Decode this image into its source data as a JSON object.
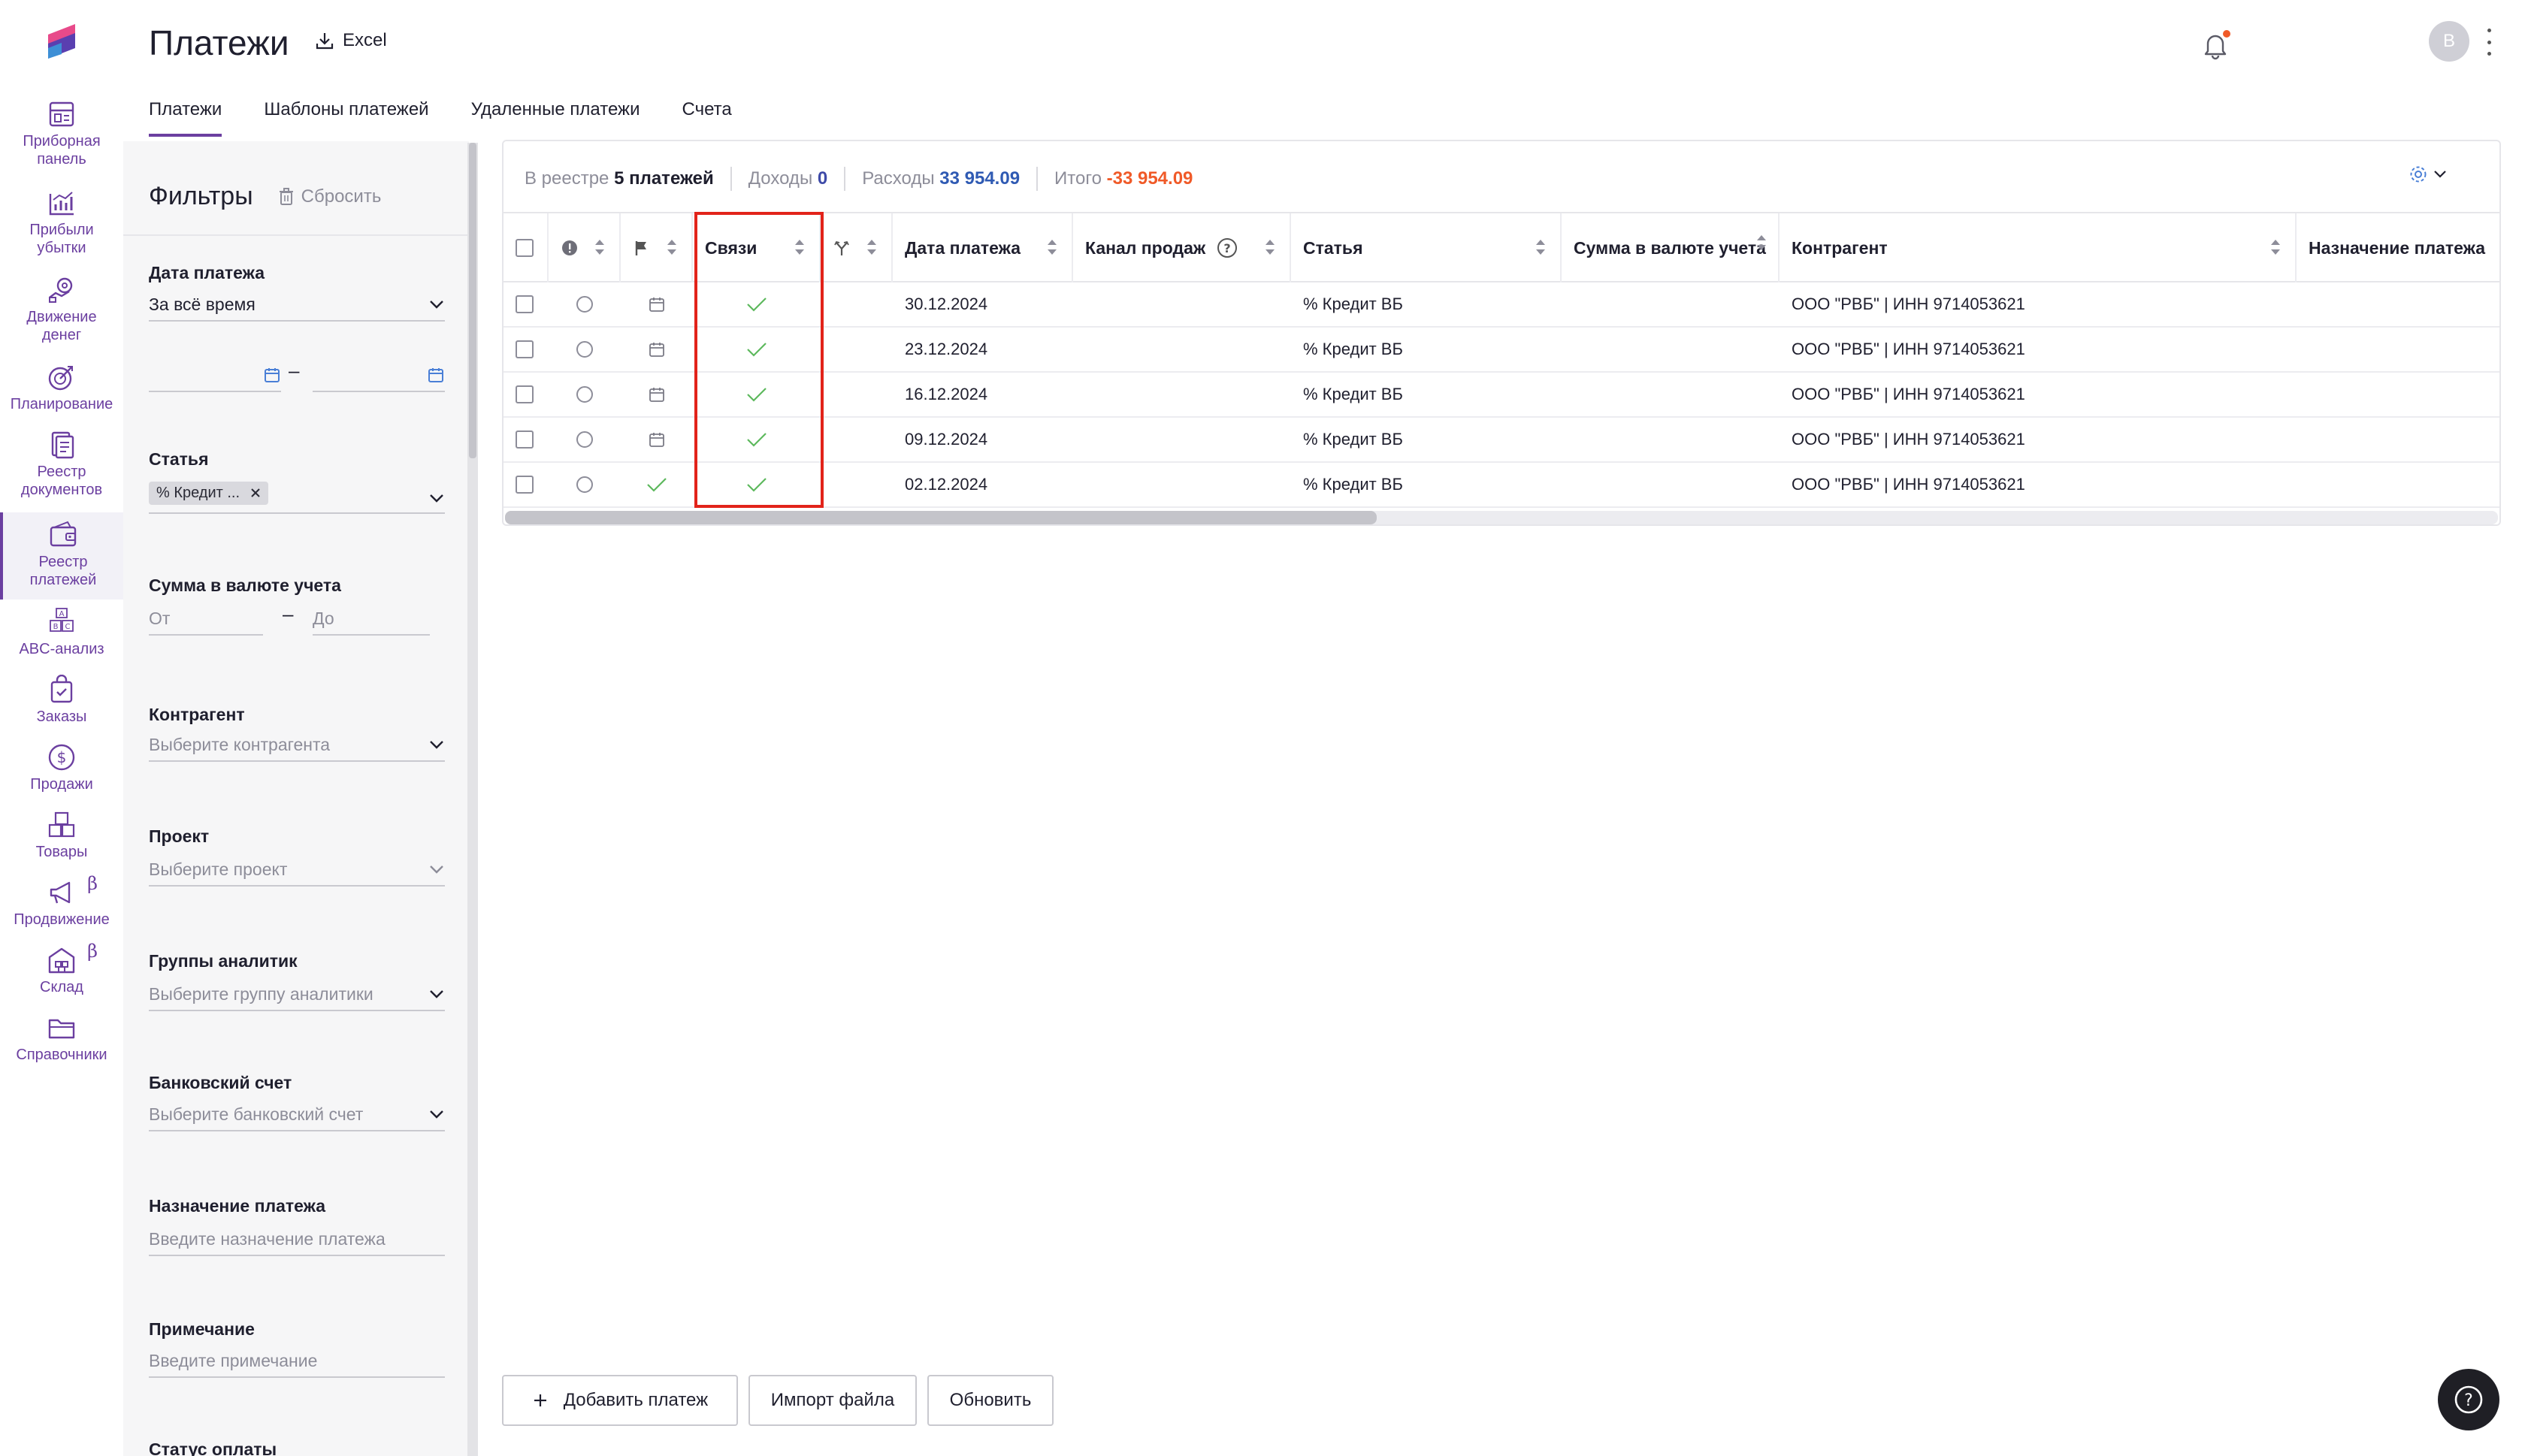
{
  "nav": {
    "items": [
      {
        "label": "Приборная\nпанель",
        "icon": "dashboard-icon"
      },
      {
        "label": "Прибыли\nубытки",
        "icon": "chart-icon"
      },
      {
        "label": "Движение\nденег",
        "icon": "money-flow-icon"
      },
      {
        "label": "Планирование",
        "icon": "target-icon"
      },
      {
        "label": "Реестр\nдокументов",
        "icon": "documents-icon"
      },
      {
        "label": "Реестр\nплатежей",
        "icon": "wallet-icon"
      },
      {
        "label": "ABC-анализ",
        "icon": "abc-icon"
      },
      {
        "label": "Заказы",
        "icon": "orders-icon"
      },
      {
        "label": "Продажи",
        "icon": "dollar-icon"
      },
      {
        "label": "Товары",
        "icon": "boxes-icon"
      },
      {
        "label": "Продвижение",
        "icon": "megaphone-icon",
        "beta": "β"
      },
      {
        "label": "Склад",
        "icon": "warehouse-icon",
        "beta": "β"
      },
      {
        "label": "Справочники",
        "icon": "folder-icon"
      }
    ]
  },
  "header": {
    "title": "Платежи",
    "excel": "Excel",
    "avatar": "В"
  },
  "tabs": [
    "Платежи",
    "Шаблоны платежей",
    "Удаленные платежи",
    "Счета"
  ],
  "filters": {
    "title": "Фильтры",
    "reset": "Сбросить",
    "date_label": "Дата платежа",
    "date_value": "За всё время",
    "date_dash": "–",
    "article_label": "Статья",
    "article_chip": "% Кредит ...",
    "amount_label": "Сумма в валюте учета",
    "amount_from": "От",
    "amount_to": "До",
    "amount_dash": "–",
    "counterparty_label": "Контрагент",
    "counterparty_ph": "Выберите контрагента",
    "project_label": "Проект",
    "project_ph": "Выберите проект",
    "groups_label": "Группы аналитик",
    "groups_ph": "Выберите группу аналитики",
    "bank_label": "Банковский счет",
    "bank_ph": "Выберите банковский счет",
    "purpose_label": "Назначение платежа",
    "purpose_ph": "Введите назначение платежа",
    "note_label": "Примечание",
    "note_ph": "Введите примечание",
    "status_label": "Статус оплаты"
  },
  "stats": {
    "registry_label": "В реестре",
    "registry_value": "5 платежей",
    "income_label": "Доходы",
    "income_value": "0",
    "expense_label": "Расходы",
    "expense_value": "33 954.09",
    "total_label": "Итого",
    "total_value": "-33 954.09"
  },
  "table": {
    "columns": {
      "links": "Связи",
      "date": "Дата платежа",
      "channel": "Канал продаж",
      "article": "Статья",
      "amount": "Сумма в валюте учета",
      "counterparty": "Контрагент",
      "purpose": "Назначение платежа"
    },
    "rows": [
      {
        "date": "30.12.2024",
        "article": "% Кредит ВБ",
        "counterparty": "ООО \"РВБ\" | ИНН 9714053621",
        "flag": "calendar"
      },
      {
        "date": "23.12.2024",
        "article": "% Кредит ВБ",
        "counterparty": "ООО \"РВБ\" | ИНН 9714053621",
        "flag": "calendar"
      },
      {
        "date": "16.12.2024",
        "article": "% Кредит ВБ",
        "counterparty": "ООО \"РВБ\" | ИНН 9714053621",
        "flag": "calendar"
      },
      {
        "date": "09.12.2024",
        "article": "% Кредит ВБ",
        "counterparty": "ООО \"РВБ\" | ИНН 9714053621",
        "flag": "calendar"
      },
      {
        "date": "02.12.2024",
        "article": "% Кредит ВБ",
        "counterparty": "ООО \"РВБ\" | ИНН 9714053621",
        "flag": "check"
      }
    ]
  },
  "actions": {
    "add": "Добавить платеж",
    "import": "Импорт файла",
    "refresh": "Обновить"
  },
  "colors": {
    "accent": "#6b3fa0",
    "highlight": "#e2231a",
    "check": "#5cb85c",
    "negative": "#f05a28"
  }
}
